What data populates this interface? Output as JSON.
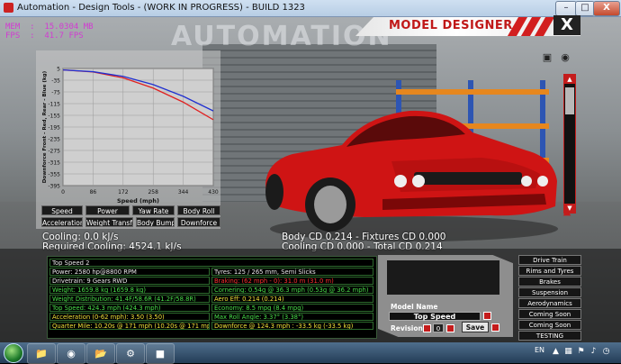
{
  "window": {
    "title": "Automation - Design Tools - (WORK IN PROGRESS) - BUILD 1323",
    "min_label": "–",
    "max_label": "□",
    "close_label": "X"
  },
  "debug": {
    "line1": "MEM  :  15.0304 MB",
    "line2": "FPS  :  41.7 FPS"
  },
  "watermark": "AUTOMATION",
  "header": {
    "title": "MODEL DESIGNER",
    "close_label": "X"
  },
  "chart_data": {
    "type": "line",
    "xlabel": "Speed (mph)",
    "ylabel": "Downforce Front - Red, Rear - Blue (kg)",
    "x_ticks": [
      0,
      86,
      172,
      258,
      344,
      430
    ],
    "y_ticks": [
      5,
      -35,
      -75,
      -115,
      -155,
      -195,
      -235,
      -275,
      -315,
      -355,
      -395
    ],
    "xlim": [
      0,
      430
    ],
    "ylim": [
      -395,
      5
    ],
    "series": [
      {
        "name": "Front",
        "color": "#e02020",
        "x": [
          0,
          86,
          172,
          258,
          344,
          430
        ],
        "y": [
          0,
          -7,
          -27,
          -62,
          -110,
          -170
        ]
      },
      {
        "name": "Rear",
        "color": "#2030d0",
        "x": [
          0,
          86,
          172,
          258,
          344,
          430
        ],
        "y": [
          0,
          -6,
          -22,
          -50,
          -90,
          -140
        ]
      }
    ],
    "grid": true
  },
  "chart_tabs": [
    [
      "Speed",
      "Power",
      "Yaw Rate",
      "Body Roll"
    ],
    [
      "Acceleration",
      "Weight Transfer",
      "Body Bump",
      "Downforce"
    ]
  ],
  "stats": {
    "cooling": "Cooling: 0.0 kJ/s",
    "required_cooling": "Required Cooling: 4524.1 kJ/s",
    "body_cd": "Body CD 0.214 - Fixtures CD 0.000",
    "cooling_cd": "Cooling CD 0.000 - Total CD 0.214"
  },
  "info": {
    "model": "Top Speed 2",
    "power": "Power: 2580 hp@8800 RPM",
    "tyres": "Tyres: 125 / 265 mm, Semi Slicks",
    "drivetrain": "Drivetrain: 9 Gears RWD",
    "braking": "Braking: (62 mph - 0): 31.0 m (31.0 m)",
    "weight": "Weight: 1659.8 kg (1659.8 kg)",
    "cornering": "Cornering: 0.54g @ 36.3 mph (0.53g @ 36.2 mph)",
    "weight_distribution": "Weight Distribution: 41.4F/58.6R (41.2F/58.8R)",
    "aero_eff": "Aero Eff: 0.214 (0.214)",
    "top_speed": "Top Speed: 424.3 mph (424.3 mph)",
    "economy": "Economy: 8.5 mpg (8.4 mpg)",
    "acceleration": "Acceleration (0-62 mph): 3.50 (3.50)",
    "max_roll_angle": "Max Roll Angle: 3.37° (3.38°)",
    "quarter_mile": "Quarter Mile: 10.20s @ 171 mph (10.20s @ 171 mph)",
    "downforce": "Downforce @ 124.3 mph : -33.5 kg (-33.5 kg)"
  },
  "model_panel": {
    "name_label": "Model Name",
    "name_value": "Top Speed",
    "revision_label": "Revision",
    "revision_value": "0",
    "save_label": "Save"
  },
  "side_menu": [
    "Drive Train",
    "Rims and Tyres",
    "Brakes",
    "Suspension",
    "Aerodynamics",
    "Coming Soon",
    "Coming Soon",
    "TESTING"
  ],
  "taskbar": {
    "lang": "EN"
  },
  "colors": {
    "accent_red": "#c41c1c",
    "info_green": "#49e04a",
    "info_red": "#ff3030",
    "info_yellow": "#f1e23a"
  }
}
